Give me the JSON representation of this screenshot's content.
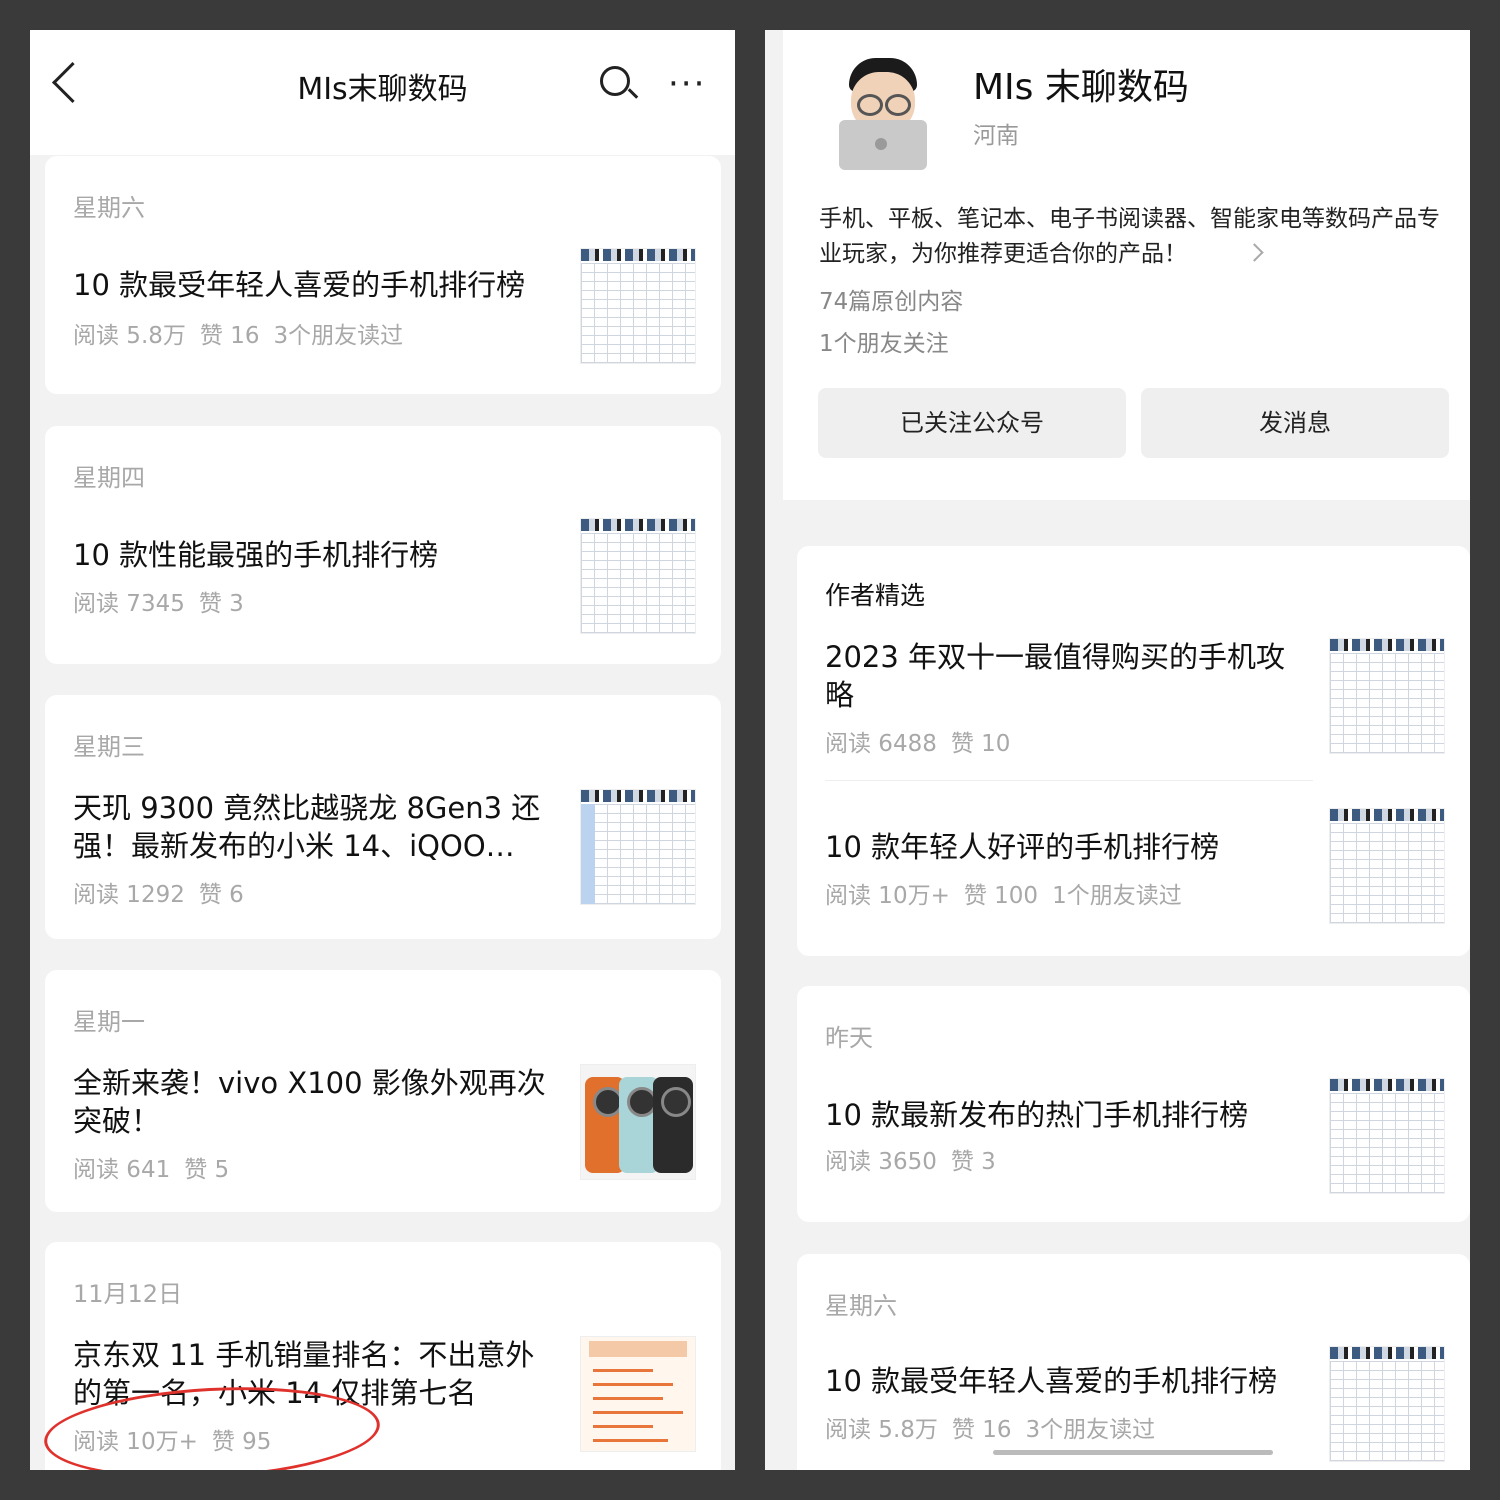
{
  "left": {
    "header": {
      "title": "MIs末聊数码",
      "back_icon": "chevron-left-icon",
      "search_icon": "search-icon",
      "more_icon": "more-icon",
      "more_glyph": "···"
    },
    "articles": [
      {
        "day": "星期六",
        "title": "10 款最受年轻人喜爱的手机排行榜",
        "meta": [
          "阅读 5.8万",
          "赞 16",
          "3个朋友读过"
        ]
      },
      {
        "day": "星期四",
        "title": "10 款性能最强的手机排行榜",
        "meta": [
          "阅读 7345",
          "赞 3"
        ]
      },
      {
        "day": "星期三",
        "title": "天玑 9300 竟然比越骁龙 8Gen3 还强！最新发布的小米 14、iQOO…",
        "meta": [
          "阅读 1292",
          "赞 6"
        ]
      },
      {
        "day": "星期一",
        "title": "全新来袭！vivo X100 影像外观再次突破！",
        "meta": [
          "阅读 641",
          "赞 5"
        ]
      },
      {
        "day": "11月12日",
        "title": "京东双 11 手机销量排名：不出意外的第一名，小米 14 仅排第七名",
        "meta": [
          "阅读 10万+",
          "赞 95"
        ]
      }
    ]
  },
  "right": {
    "profile": {
      "name": "MIs 末聊数码",
      "location": "河南",
      "description": "手机、平板、笔记本、电子书阅读器、智能家电等数码产品专业玩家，为你推荐更适合你的产品！",
      "original_count": "74篇原创内容",
      "friends_follow": "1个朋友关注",
      "follow_button": "已关注公众号",
      "message_button": "发消息"
    },
    "featured": {
      "section_title": "作者精选",
      "items": [
        {
          "title": "2023 年双十一最值得购买的手机攻略",
          "meta": [
            "阅读 6488",
            "赞 10"
          ]
        },
        {
          "title": "10 款年轻人好评的手机排行榜",
          "meta": [
            "阅读 10万+",
            "赞 100",
            "1个朋友读过"
          ]
        }
      ]
    },
    "feed": [
      {
        "day": "昨天",
        "title": "10 款最新发布的热门手机排行榜",
        "meta": [
          "阅读 3650",
          "赞 3"
        ]
      },
      {
        "day": "星期六",
        "title": "10 款最受年轻人喜爱的手机排行榜",
        "meta": [
          "阅读 5.8万",
          "赞 16",
          "3个朋友读过"
        ]
      }
    ]
  },
  "colors": {
    "annotation_circle": "#e0322c",
    "meta_gray": "#a8a8a8",
    "background": "#f2f2f2"
  }
}
